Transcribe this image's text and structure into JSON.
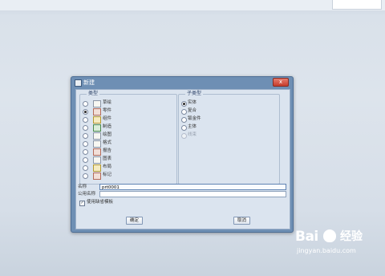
{
  "dialog": {
    "title": "新建",
    "close_label": "x",
    "type_group_label": "类型",
    "type_options": [
      {
        "label": "草绘",
        "icon": "sketch-icon",
        "selected": false
      },
      {
        "label": "零件",
        "icon": "part-icon",
        "selected": true
      },
      {
        "label": "组件",
        "icon": "assembly-icon",
        "selected": false
      },
      {
        "label": "制造",
        "icon": "manufacturing-icon",
        "selected": false
      },
      {
        "label": "绘图",
        "icon": "drawing-icon",
        "selected": false
      },
      {
        "label": "格式",
        "icon": "format-icon",
        "selected": false
      },
      {
        "label": "报告",
        "icon": "report-icon",
        "selected": false
      },
      {
        "label": "图表",
        "icon": "diagram-icon",
        "selected": false
      },
      {
        "label": "布局",
        "icon": "layout-icon",
        "selected": false
      },
      {
        "label": "标记",
        "icon": "markup-icon",
        "selected": false
      }
    ],
    "subtype_group_label": "子类型",
    "subtype_options": [
      {
        "label": "实体",
        "selected": true,
        "disabled": false
      },
      {
        "label": "复合",
        "selected": false,
        "disabled": false
      },
      {
        "label": "钣金件",
        "selected": false,
        "disabled": false
      },
      {
        "label": "主体",
        "selected": false,
        "disabled": false
      },
      {
        "label": "线束",
        "selected": false,
        "disabled": true
      }
    ],
    "name_label": "名称",
    "name_value": "prt0001",
    "common_name_label": "公用名称",
    "common_name_value": "",
    "use_default_template_label": "使用缺省模板",
    "use_default_template_checked": true,
    "ok_label": "确定",
    "cancel_label": "取消"
  },
  "watermark": {
    "logo_text": "Bai",
    "cn_text": "经验",
    "url": "jingyan.baidu.com"
  },
  "colors": {
    "desktop": "#d9e1ea",
    "frame": "#6e8fb4",
    "client": "#dbe4ef"
  }
}
